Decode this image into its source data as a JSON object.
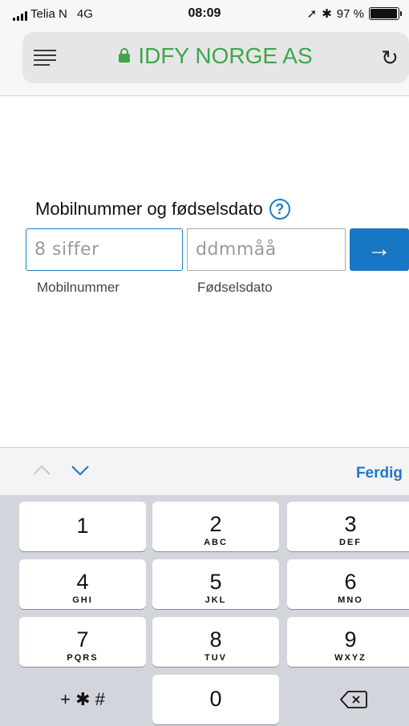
{
  "status": {
    "carrier": "Telia N",
    "network": "4G",
    "time": "08:09",
    "battery": "97 %",
    "battery_level": 0.97
  },
  "browser": {
    "site_title": "IDFY NORGE AS",
    "lock_color": "#3fa64a"
  },
  "form": {
    "label": "Mobilnummer og fødselsdato",
    "help_symbol": "?",
    "phone_placeholder": "8 siffer",
    "dob_placeholder": "ddmmåå",
    "submit_symbol": "→",
    "phone_hint": "Mobilnummer",
    "dob_hint": "Fødselsdato",
    "accent": "#1777c4"
  },
  "accessory": {
    "done_label": "Ferdig"
  },
  "keypad": {
    "keys": [
      {
        "num": "1",
        "letters": ""
      },
      {
        "num": "2",
        "letters": "ABC"
      },
      {
        "num": "3",
        "letters": "DEF"
      },
      {
        "num": "4",
        "letters": "GHI"
      },
      {
        "num": "5",
        "letters": "JKL"
      },
      {
        "num": "6",
        "letters": "MNO"
      },
      {
        "num": "7",
        "letters": "PQRS"
      },
      {
        "num": "8",
        "letters": "TUV"
      },
      {
        "num": "9",
        "letters": "WXYZ"
      },
      {
        "num": "0",
        "letters": ""
      }
    ],
    "symbols_label": "+ ✱ #"
  }
}
